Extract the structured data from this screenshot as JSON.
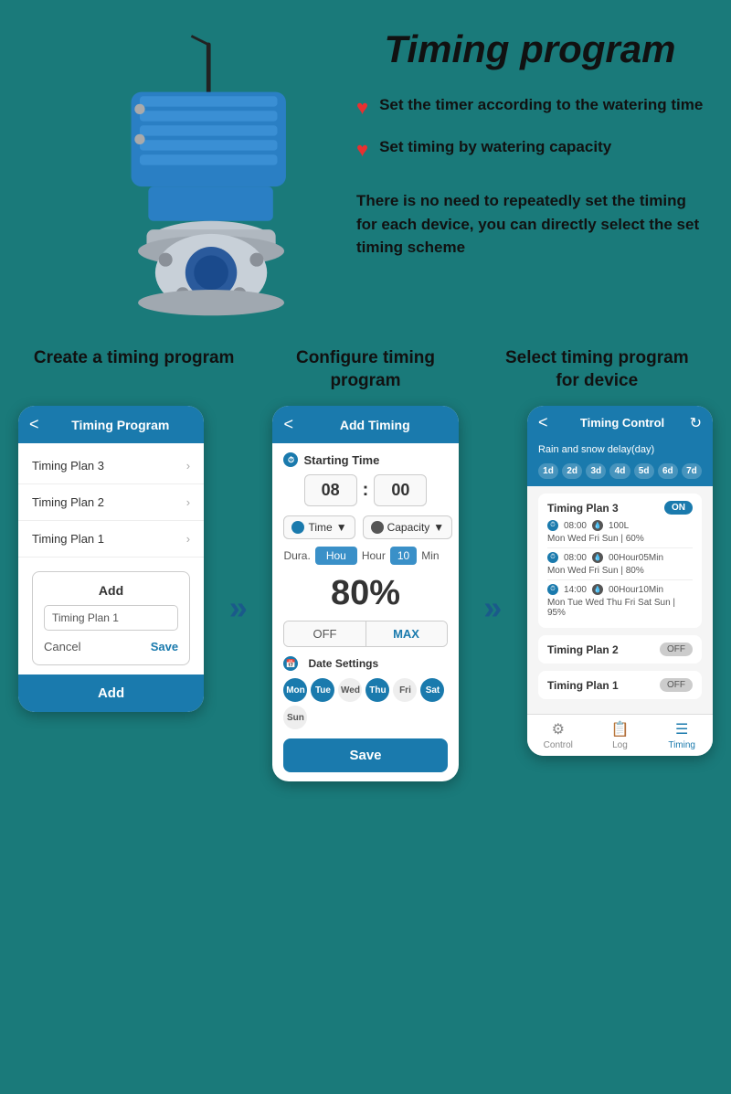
{
  "page": {
    "title": "Timing program",
    "background": "#1a7a7a"
  },
  "top": {
    "bullet1": "Set the timer according to the watering time",
    "bullet2": "Set timing by watering capacity",
    "description": "There is no need to repeatedly set the timing for each device, you can directly select the set timing scheme"
  },
  "steps": [
    {
      "title": "Create a timing program"
    },
    {
      "title": "Configure timing program"
    },
    {
      "title": "Select timing program for device"
    }
  ],
  "phone1": {
    "header": "Timing Program",
    "plans": [
      "Timing Plan 3",
      "Timing Plan 2",
      "Timing Plan 1"
    ],
    "dialog_title": "Add",
    "input_placeholder": "Timing Plan 1",
    "cancel": "Cancel",
    "save": "Save",
    "add_button": "Add"
  },
  "phone2": {
    "header": "Add Timing",
    "starting_time": "Starting Time",
    "hour": "08",
    "minute": "00",
    "type1": "Time",
    "type2": "Capacity",
    "dura_label": "Dura.",
    "hour_label": "Hour",
    "min_value": "10",
    "min_label": "Min",
    "percent": "80%",
    "off": "OFF",
    "max": "MAX",
    "date_settings": "Date Settings",
    "days": [
      "Mon",
      "Tue",
      "Wed",
      "Thu",
      "Fri",
      "Sat",
      "Sun"
    ],
    "active_days": [
      1,
      1,
      0,
      1,
      0,
      1,
      0
    ],
    "save": "Save"
  },
  "phone3": {
    "header": "Timing Control",
    "rain_delay": "Rain and snow delay(day)",
    "day_btns": [
      "1d",
      "2d",
      "3d",
      "4d",
      "5d",
      "6d",
      "7d"
    ],
    "plan3": {
      "name": "Timing Plan 3",
      "toggle": "ON",
      "schedule1_time": "08:00",
      "schedule1_cap": "100L",
      "schedule1_days": "Mon  Wed  Fri  Sun | 60%",
      "schedule2_time": "08:00",
      "schedule2_cap": "00Hour05Min",
      "schedule2_days": "Mon  Wed  Fri  Sun | 80%",
      "schedule3_time": "14:00",
      "schedule3_cap": "00Hour10Min",
      "schedule3_days": "Mon Tue Wed Thu Fri Sat Sun | 95%"
    },
    "plan2": {
      "name": "Timing Plan 2",
      "toggle": "OFF"
    },
    "plan1": {
      "name": "Timing Plan 1",
      "toggle": "OFF"
    },
    "nav": [
      "Control",
      "Log",
      "Timing"
    ]
  },
  "arrows": {
    "symbol": "»"
  }
}
